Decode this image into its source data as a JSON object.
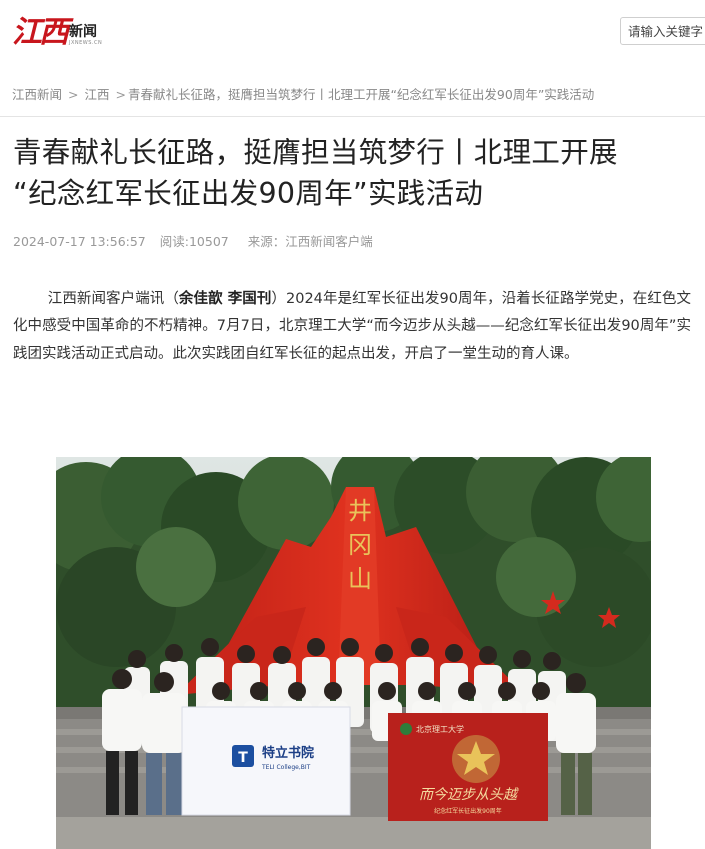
{
  "header": {
    "logo_mark": "江西",
    "logo_cn": "新闻",
    "logo_en": "JXNEWS.CN",
    "search_placeholder": "请输入关键字"
  },
  "breadcrumb": {
    "items": [
      "江西新闻",
      "江西"
    ],
    "separator": ">",
    "current": "青春献礼长征路，挺膺担当筑梦行丨北理工开展“纪念红军长征出发90周年”实践活动"
  },
  "article": {
    "title_line1": "青春献礼长征路，挺膺担当筑梦行丨北理工开展",
    "title_line2": "“纪念红军长征出发90周年”实践活动",
    "date": "2024-07-17 13:56:57",
    "reads": "阅读:10507",
    "source": "来源：江西新闻客户端",
    "lead_prefix": "江西新闻客户端讯（",
    "authors": "余佳歆 李国刊",
    "lead_rest": "）2024年是红军长征出发90周年，沿着长征路学党史，在红色文化中感受中国革命的不朽精神。7月7日，北京理工大学“而今迈步从头越——纪念红军长征出发90周年”实践团实践活动正式启动。此次实践团自红军长征的起点出发，开启了一堂生动的育人课。"
  },
  "photo": {
    "monument_text": "井冈山",
    "banner_left_cn": "特立书院",
    "banner_left_en": "TELI College,BIT",
    "banner_right_school": "北京理工大学",
    "banner_right_slogan": "而今迈步从头越",
    "banner_right_sub": "纪念红军长征出发90周年"
  },
  "colors": {
    "brand_red": "#c8161d",
    "monument_red": "#d62a1e",
    "banner_red": "#b8211c"
  }
}
